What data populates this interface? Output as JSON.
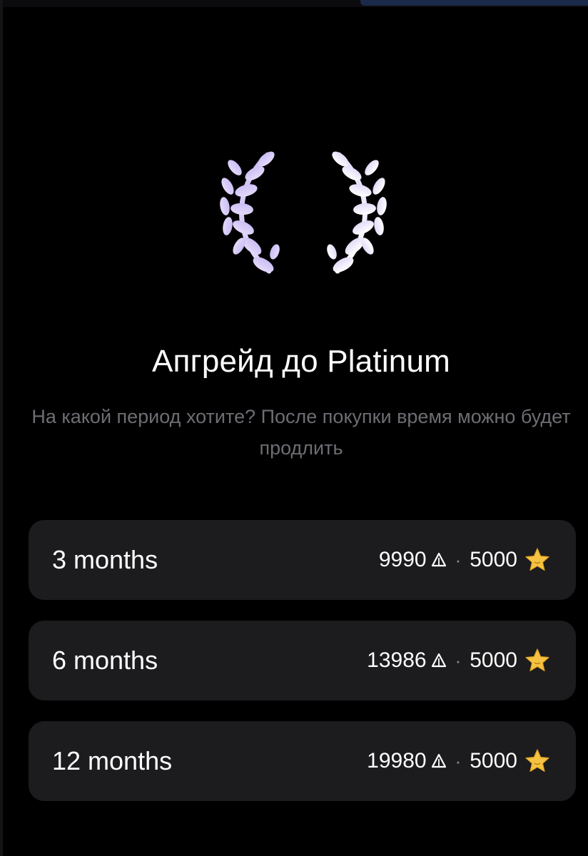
{
  "header": {
    "title": "Апгрейд до Platinum",
    "subtitle": "На какой период хотите? После покупки время можно будет продлить"
  },
  "icons": {
    "laurel": "laurel-wreath-icon",
    "currency": "delta-currency-icon",
    "star": "star-icon"
  },
  "colors": {
    "background": "#000000",
    "card": "#1c1c1e",
    "subtitle": "#6d6d73",
    "laurel_left": "#d6c9f7",
    "laurel_right": "#f3eefe",
    "star": "#f5c242"
  },
  "plans": [
    {
      "label": "3 months",
      "price": "9990",
      "separator": "·",
      "stars": "5000"
    },
    {
      "label": "6 months",
      "price": "13986",
      "separator": "·",
      "stars": "5000"
    },
    {
      "label": "12 months",
      "price": "19980",
      "separator": "·",
      "stars": "5000"
    }
  ]
}
